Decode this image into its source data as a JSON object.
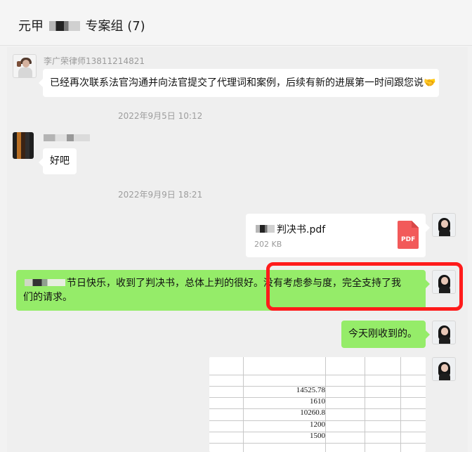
{
  "window": {
    "title": "元甲",
    "member_count": "专案组 (7)"
  },
  "messages": [
    {
      "sender": "李广荣律师13811214821",
      "text": "已经再次联系法官沟通并向法官提交了代理词和案例，后续有新的进展第一时间跟您说🤝"
    },
    {
      "timestamp": "2022年9月5日 10:12"
    },
    {
      "text": "好吧"
    },
    {
      "timestamp": "2022年9月9日 18:21"
    },
    {
      "file_name": "判决书.pdf",
      "file_size": "202 KB",
      "file_icon": "PDF"
    },
    {
      "text_line_1": "节日快乐，收到了判决书，总体上判的很好。没有考虑参与度，完全支持了我",
      "text_line_2": "们的请求。"
    },
    {
      "text": "今天刚收到的。"
    }
  ],
  "image_preview": {
    "values": [
      "14525.78",
      "1610",
      "10260.8",
      "1200",
      "1500"
    ]
  },
  "colors": {
    "green_bubble": "#95ec69",
    "highlight_red": "#ff1b1b",
    "pdf_red": "#f25a5a"
  }
}
